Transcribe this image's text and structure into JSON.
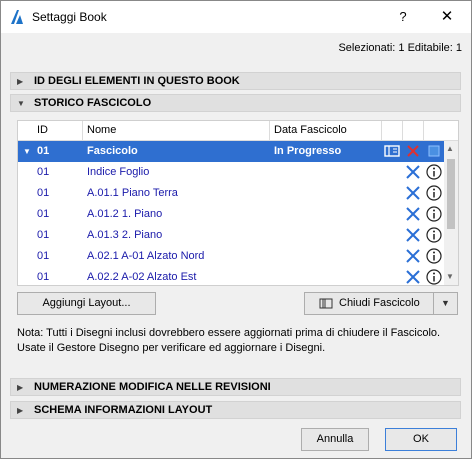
{
  "window": {
    "title": "Settaggi Book",
    "help_label": "?",
    "close_label": "✕"
  },
  "selection_info": "Selezionati: 1 Editabile: 1",
  "sections": {
    "id_elements": "ID DEGLI ELEMENTI IN QUESTO BOOK",
    "history": "STORICO FASCICOLO",
    "numbering": "NUMERAZIONE MODIFICA NELLE REVISIONI",
    "layout_schema": "SCHEMA INFORMAZIONI LAYOUT"
  },
  "table": {
    "columns": [
      "ID",
      "Nome",
      "Data Fascicolo"
    ],
    "selected_row": {
      "id": "01",
      "name": "Fascicolo",
      "date": "In Progresso"
    },
    "rows": [
      {
        "id": "01",
        "name": "Indice Foglio"
      },
      {
        "id": "01",
        "name": "A.01.1 Piano Terra"
      },
      {
        "id": "01",
        "name": "A.01.2 1. Piano"
      },
      {
        "id": "01",
        "name": "A.01.3 2. Piano"
      },
      {
        "id": "01",
        "name": "A.02.1 A-01 Alzato Nord"
      },
      {
        "id": "01",
        "name": "A.02.2 A-02 Alzato Est"
      }
    ]
  },
  "buttons": {
    "add_layout": "Aggiungi Layout...",
    "close_issue": "Chiudi Fascicolo",
    "cancel": "Annulla",
    "ok": "OK"
  },
  "note": "Nota: Tutti i Disegni inclusi dovrebbero essere aggiornati prima di chiudere il Fascicolo. Usate il Gestore Disegno per verificare ed aggiornare i Disegni.",
  "colors": {
    "selection": "#2f6fd0",
    "row_text": "#1a1aaa",
    "remove_icon": "#2a6fd6",
    "delete_red": "#e03030"
  },
  "icons": {
    "remove": "remove-x-icon",
    "info": "info-icon",
    "layout": "layout-icon"
  }
}
